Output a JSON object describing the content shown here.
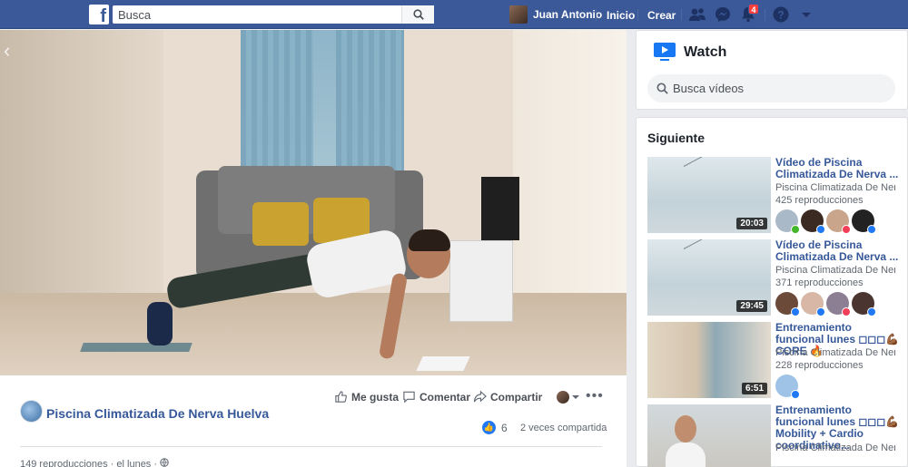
{
  "topbar": {
    "logo": "f",
    "search_placeholder": "Busca",
    "user_name": "Juan Antonio",
    "nav_home": "Inicio",
    "nav_create": "Crear",
    "notifications_count": "4",
    "icons": [
      "friends-icon",
      "messenger-icon",
      "bell-icon",
      "help-icon",
      "caret-down-icon"
    ]
  },
  "post": {
    "page_name": "Piscina Climatizada De Nerva Huelva",
    "actions": {
      "like": "Me gusta",
      "comment": "Comentar",
      "share": "Compartir"
    },
    "reaction_count": "6",
    "shares": "2 veces compartida",
    "stats": "149 reproducciones · el lunes ·"
  },
  "watch": {
    "title": "Watch",
    "search_placeholder": "Busca vídeos",
    "next_label": "Siguiente",
    "videos": [
      {
        "title": "Vídeo de Piscina Climatizada De Nerva ...",
        "channel": "Piscina Climatizada De Ner...",
        "views": "425 reproducciones",
        "duration": "20:03"
      },
      {
        "title": "Vídeo de Piscina Climatizada De Nerva ...",
        "channel": "Piscina Climatizada De Ner...",
        "views": "371 reproducciones",
        "duration": "29:45"
      },
      {
        "title": "Entrenamiento funcional lunes ◻◻◻💪🏾 CORE 🔥",
        "channel": "Piscina Climatizada De Ner...",
        "views": "228 reproducciones",
        "duration": "6:51"
      },
      {
        "title": "Entrenamiento funcional lunes ◻◻◻💪🏾 Mobility + Cardio coordinativo...",
        "channel": "Piscina Climatizada De Ner...",
        "views": "",
        "duration": ""
      }
    ]
  },
  "colors": {
    "brand": "#3b5998",
    "link": "#365899",
    "like": "#2078f4",
    "badge": "#fa3e3e"
  }
}
